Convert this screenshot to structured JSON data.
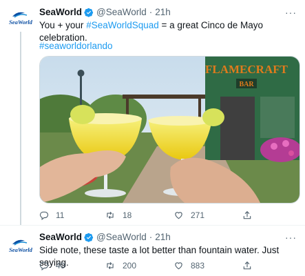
{
  "tweets": [
    {
      "account_name": "SeaWorld",
      "handle": "@SeaWorld",
      "separator": "·",
      "time": "21h",
      "text_parts": [
        "You + your ",
        "#SeaWorldSquad",
        " = a great Cinco de Mayo celebration."
      ],
      "hashtag_line": "#seaworldorlando",
      "image_sign": "FLAMECRAFT",
      "image_sign_sub": "BAR",
      "more": "···",
      "replies": "11",
      "retweets": "18",
      "likes": "271"
    },
    {
      "account_name": "SeaWorld",
      "handle": "@SeaWorld",
      "separator": "·",
      "time": "21h",
      "text": "Side note, these taste a lot better than fountain water. Just saying.",
      "more": "···",
      "replies": "40",
      "retweets": "200",
      "likes": "883"
    }
  ],
  "logo_text": "SeaWorld",
  "colors": {
    "accent": "#1d9bf0",
    "text": "#0f1419",
    "muted": "#536471",
    "logo_blue": "#0b4ea2"
  },
  "icons": [
    "reply-icon",
    "retweet-icon",
    "like-icon",
    "share-icon",
    "verified-icon",
    "more-icon"
  ]
}
